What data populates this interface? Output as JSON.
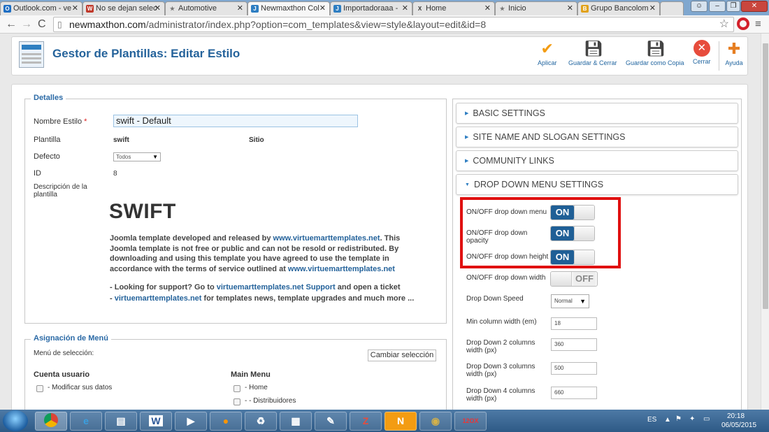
{
  "browser": {
    "tabs": [
      {
        "label": "Outlook.com - ve",
        "fav": "O",
        "color": "#1e6fc4"
      },
      {
        "label": "No se dejan selec",
        "fav": "W",
        "color": "#c0392b"
      },
      {
        "label": "Automotive",
        "fav": "★",
        "color": "#777"
      },
      {
        "label": "Newmaxthon Col",
        "fav": "J",
        "color": "#2e7ec2"
      },
      {
        "label": "Importadoraaa -",
        "fav": "J",
        "color": "#2e7ec2"
      },
      {
        "label": "Home",
        "fav": "X",
        "color": "#333"
      },
      {
        "label": "Inicio",
        "fav": "★",
        "color": "#777"
      },
      {
        "label": "Grupo Bancolom",
        "fav": "B",
        "color": "#e1a21b"
      }
    ],
    "url_host": "newmaxthon.com",
    "url_path": "/administrator/index.php?option=com_templates&view=style&layout=edit&id=8"
  },
  "toolbar": {
    "title": "Gestor de Plantillas: Editar Estilo",
    "buttons": [
      {
        "label": "Aplicar",
        "icon": "checkmark-icon"
      },
      {
        "label": "Guardar & Cerrar",
        "icon": "save-icon"
      },
      {
        "label": "Guardar como Copia",
        "icon": "save-copy-icon"
      },
      {
        "label": "Cerrar",
        "icon": "close-icon"
      },
      {
        "label": "Ayuda",
        "icon": "help-icon"
      }
    ]
  },
  "details": {
    "legend": "Detalles",
    "nombre_label": "Nombre Estilo",
    "required_mark": "*",
    "nombre_value": "swift - Default",
    "plantilla_label": "Plantilla",
    "plantilla_value": "swift",
    "sitio_value": "Sitio",
    "defecto_label": "Defecto",
    "defecto_value": "Todos",
    "id_label": "ID",
    "id_value": "8",
    "desc_label": "Descripción de la plantilla",
    "swift_title": "SWIFT",
    "para1_a": "Joomla template developed and released by ",
    "para1_link": "www.virtuemarttemplates.net",
    "para1_b": ". This Joomla template is not free or public and can not be resold or redistributed. By downloading and using this template you have agreed to use the template in accordance with the terms of service outlined at ",
    "para1_link2": "www.virtuemarttemplates.net",
    "para2_a": "- Looking for support? Go to ",
    "para2_link": "virtuemarttemplates.net Support",
    "para2_b": " and open a ticket",
    "para3_a": "- ",
    "para3_link": "virtuemarttemplates.net",
    "para3_b": " for templates news, template upgrades and much more ..."
  },
  "menu_assignment": {
    "legend": "Asignación de Menú",
    "select_label": "Menú de selección:",
    "change_button": "Cambiar selección",
    "col1_title": "Cuenta usuario",
    "col1_items": [
      "- Modificar sus datos"
    ],
    "col2_title": "Main Menu",
    "col2_items": [
      "- Home",
      "- - Distribuidores"
    ]
  },
  "settings": {
    "sections": [
      "BASIC SETTINGS",
      "SITE NAME AND SLOGAN SETTINGS",
      "COMMUNITY LINKS",
      "DROP DOWN MENU SETTINGS"
    ],
    "on_text": "ON",
    "off_text": "OFF",
    "rows": {
      "menu_label": "ON/OFF drop down menu",
      "opacity_label": "ON/OFF drop down opacity",
      "height_label": "ON/OFF drop down height",
      "width_label": "ON/OFF drop down width",
      "speed_label": "Drop Down Speed",
      "speed_value": "Normal",
      "mincol_label": "Min column width (em)",
      "mincol_value": "18",
      "col2_label": "Drop Down 2 columns width (px)",
      "col2_value": "360",
      "col3_label": "Drop Down 3 columns width (px)",
      "col3_value": "500",
      "col4_label": "Drop Down 4 columns width (px)",
      "col4_value": "660"
    }
  },
  "taskbar": {
    "apps": [
      "chrome",
      "ie",
      "explorer",
      "W",
      "media",
      "firefox",
      "recycle",
      "calc",
      "pen",
      "Z",
      "N",
      "coin",
      "12OX"
    ],
    "lang": "ES",
    "time": "20:18",
    "date": "06/05/2015"
  }
}
